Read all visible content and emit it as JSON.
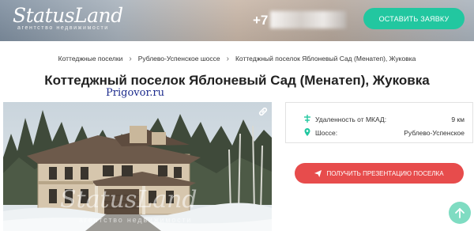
{
  "header": {
    "logo_main": "StatusLand",
    "logo_sub": "агентство недвижимости",
    "phone_prefix": "+7",
    "cta_label": "ОСТАВИТЬ ЗАЯВКУ",
    "accent_color": "#22c7a0"
  },
  "breadcrumbs": [
    "Коттеджные поселки",
    "Рублево-Успенское шоссе",
    "Коттеджный поселок Яблоневый Сад (Менатеп), Жуковка"
  ],
  "title": "Коттеджный поселок Яблоневый Сад (Менатеп), Жуковка",
  "watermark_top": "Prigovor.ru",
  "photo": {
    "watermark": "StatusLand",
    "watermark_sub": "агентство недвижимости",
    "expand_icon": "link-icon"
  },
  "info": {
    "rows": [
      {
        "label": "Удаленность от МКАД:",
        "value": "9 км",
        "icon": "road-icon"
      },
      {
        "label": "Шоссе:",
        "value": "Рублево-Успенское",
        "icon": "map-pin-icon"
      }
    ],
    "icon_color": "#22c7a0"
  },
  "cta_presentation": {
    "label": "ПОЛУЧИТЬ ПРЕЗЕНТАЦИЮ ПОСЕЛКА",
    "icon": "paper-plane-icon",
    "color": "#e74c4c"
  },
  "scroll_top_icon": "arrow-up-icon"
}
